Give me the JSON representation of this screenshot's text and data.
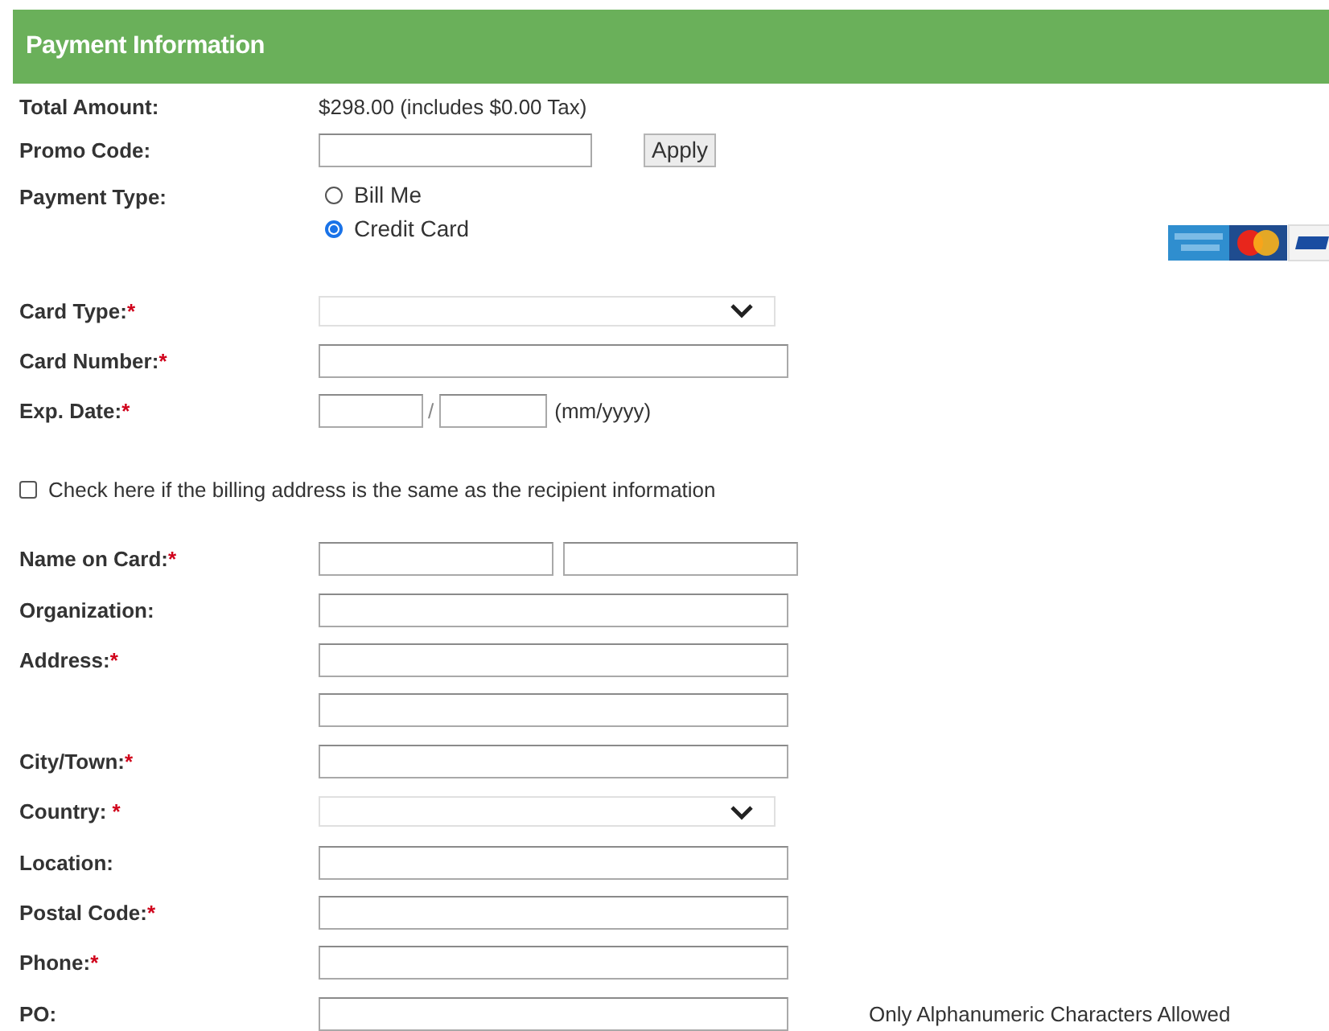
{
  "section": {
    "title": "Payment Information"
  },
  "required_mark": "*",
  "rows": [
    {
      "kind": "text",
      "label": "Total Amount:",
      "value": "$298.00 (includes $0.00 Tax)"
    },
    {
      "kind": "promo",
      "label": "Promo Code:",
      "button": "Apply"
    },
    {
      "kind": "radio",
      "label": "Payment Type:",
      "options": [
        {
          "label": "Bill Me",
          "selected": false
        },
        {
          "label": "Credit Card",
          "selected": true
        }
      ]
    },
    {
      "kind": "select",
      "label": "Card Type:",
      "required": true
    },
    {
      "kind": "input",
      "label": "Card Number:",
      "required": true
    },
    {
      "kind": "date",
      "label": "Exp. Date:",
      "required": true,
      "separator": "/",
      "hint": "(mm/yyyy)"
    },
    {
      "kind": "checkbox",
      "label": "Check here if the billing address is the same as the recipient information",
      "checked": false
    },
    {
      "kind": "pair",
      "label": "Name on Card:",
      "required": true
    },
    {
      "kind": "input",
      "label": "Organization:",
      "required": false
    },
    {
      "kind": "input",
      "label": "Address:",
      "required": true
    },
    {
      "kind": "input"
    },
    {
      "kind": "input",
      "label": "City/Town:",
      "required": true
    },
    {
      "kind": "select",
      "label": "Country: ",
      "required": true
    },
    {
      "kind": "input",
      "label": "Location:",
      "required": false
    },
    {
      "kind": "input",
      "label": "Postal Code:",
      "required": true
    },
    {
      "kind": "input",
      "label": "Phone:",
      "required": true
    },
    {
      "kind": "input",
      "label": "PO:",
      "required": false,
      "note": "Only Alphanumeric Characters Allowed"
    }
  ]
}
